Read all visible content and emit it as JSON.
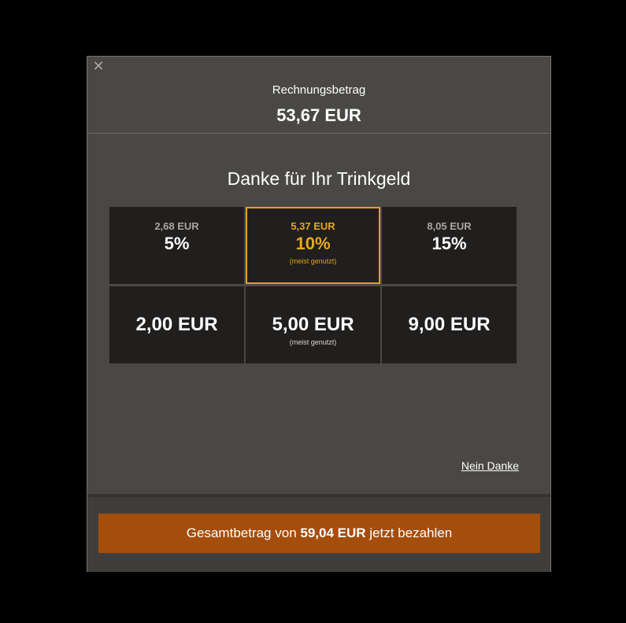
{
  "header": {
    "label": "Rechnungsbetrag",
    "amount": "53,67 EUR"
  },
  "close_icon": "close-icon",
  "thanks_title": "Danke für Ihr Trinkgeld",
  "percent_tips": [
    {
      "amount": "2,68 EUR",
      "percent": "5%",
      "note": ""
    },
    {
      "amount": "5,37 EUR",
      "percent": "10%",
      "note": "(meist genutzt)",
      "selected": true
    },
    {
      "amount": "8,05 EUR",
      "percent": "15%",
      "note": ""
    }
  ],
  "fixed_tips": [
    {
      "amount": "2,00 EUR",
      "note": ""
    },
    {
      "amount": "5,00 EUR",
      "note": "(meist genutzt)"
    },
    {
      "amount": "9,00 EUR",
      "note": ""
    }
  ],
  "no_thanks": "Nein Danke",
  "pay": {
    "prefix": "Gesamtbetrag von ",
    "total": "59,04 EUR",
    "suffix": " jetzt bezahlen"
  },
  "colors": {
    "accent": "#e0a418",
    "pay_button": "#a54d0b",
    "modal_bg": "#4a4845",
    "tile_bg": "#201f1e"
  }
}
